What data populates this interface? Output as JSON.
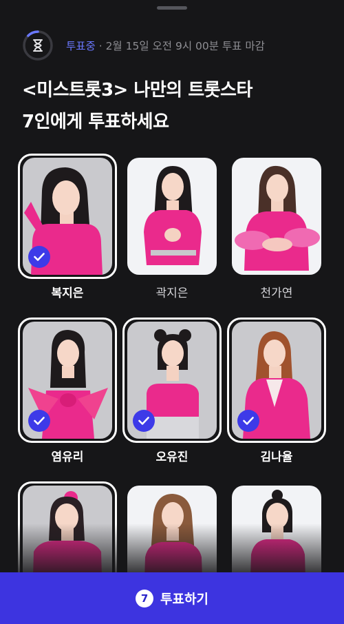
{
  "status": {
    "live_label": "투표중",
    "separator": " · ",
    "deadline": "2월 15일 오전 9시 00분 투표 마감",
    "timer_icon": "hourglass-icon"
  },
  "title": {
    "line1": "<미스트롯3> 나만의 트롯스타",
    "line2": "7인에게 투표하세요"
  },
  "candidates": [
    {
      "name": "복지은",
      "selected": true
    },
    {
      "name": "곽지은",
      "selected": false
    },
    {
      "name": "천가연",
      "selected": false
    },
    {
      "name": "염유리",
      "selected": true
    },
    {
      "name": "오유진",
      "selected": true
    },
    {
      "name": "김나율",
      "selected": true
    },
    {
      "name": "",
      "selected": true
    },
    {
      "name": "",
      "selected": false
    },
    {
      "name": "",
      "selected": false
    }
  ],
  "vote_button": {
    "count": "7",
    "label": "투표하기"
  },
  "colors": {
    "background": "#161618",
    "accent": "#3d34e0",
    "live": "#6a78ff",
    "check": "#3d3ae8",
    "outfit": "#ea2a8c"
  }
}
